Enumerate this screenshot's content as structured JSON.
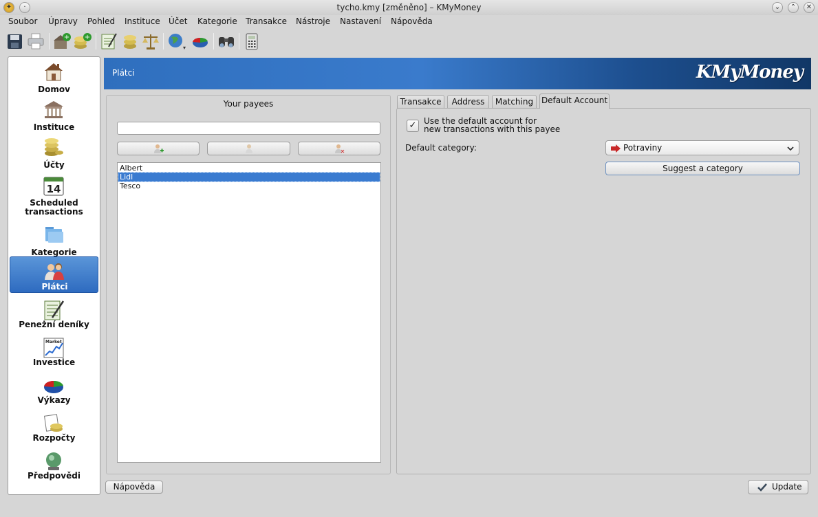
{
  "window": {
    "title": "tycho.kmy [změněno] – KMyMoney"
  },
  "menu": [
    "Soubor",
    "Úpravy",
    "Pohled",
    "Instituce",
    "Účet",
    "Kategorie",
    "Transakce",
    "Nástroje",
    "Nastavení",
    "Nápověda"
  ],
  "toolbar": {
    "icons": [
      "save-icon",
      "print-icon",
      "new-institution-icon",
      "new-account-icon",
      "ledger-icon",
      "coins-icon",
      "reconcile-scale-icon",
      "currency-globe-icon",
      "chart-icon",
      "find-binoculars-icon",
      "calculator-icon"
    ]
  },
  "sidebar": {
    "items": [
      {
        "label": "Domov",
        "icon": "home-icon"
      },
      {
        "label": "Instituce",
        "icon": "bank-icon"
      },
      {
        "label": "Účty",
        "icon": "coins-icon"
      },
      {
        "label": "Scheduled transactions",
        "icon": "calendar-icon",
        "calendar_day": "14"
      },
      {
        "label": "Kategorie",
        "icon": "folders-icon"
      },
      {
        "label": "Plátci",
        "icon": "people-icon",
        "active": true
      },
      {
        "label": "Peneżní deníky",
        "icon": "ledger-icon"
      },
      {
        "label": "Investice",
        "icon": "market-chart-icon",
        "icon_caption": "Market"
      },
      {
        "label": "Výkazy",
        "icon": "pie-chart-icon"
      },
      {
        "label": "Rozpočty",
        "icon": "budget-icon"
      },
      {
        "label": "Předpovědi",
        "icon": "crystal-ball-icon"
      }
    ]
  },
  "header": {
    "title": "Plátci",
    "logo": "KMyMoney",
    "accent": "#2f6fbe"
  },
  "payees": {
    "heading": "Your payees",
    "search_value": "",
    "buttons": [
      "add-payee-icon",
      "rename-payee-icon",
      "delete-payee-icon"
    ],
    "list": [
      "Albert",
      "Lidl",
      "Tesco"
    ],
    "selected": "Lidl"
  },
  "tabs": [
    "Transakce",
    "Address",
    "Matching",
    "Default Account"
  ],
  "active_tab": "Default Account",
  "default_account": {
    "use_default_label_line1": "Use the default account for",
    "use_default_label_line2": "new transactions with this payee",
    "use_default_checked": true,
    "category_label": "Default category:",
    "category_value": "Potraviny",
    "suggest_button": "Suggest a category"
  },
  "footer": {
    "help_button": "Nápověda",
    "update_button": "Update"
  }
}
